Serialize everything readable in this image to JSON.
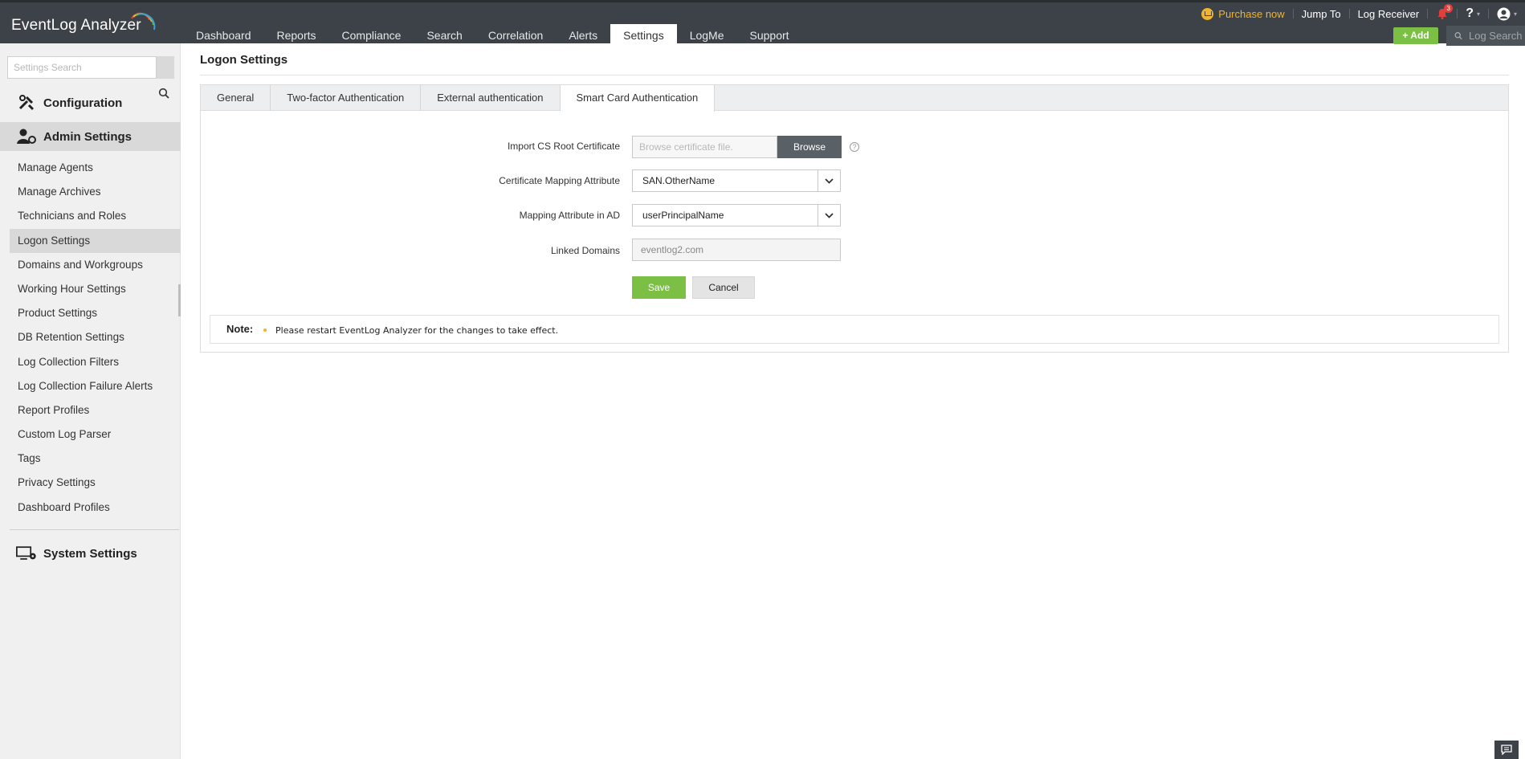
{
  "app": {
    "name": "EventLog Analyzer"
  },
  "top_nav": {
    "items": [
      "Dashboard",
      "Reports",
      "Compliance",
      "Search",
      "Correlation",
      "Alerts",
      "Settings",
      "LogMe",
      "Support"
    ],
    "active": "Settings"
  },
  "top_right": {
    "purchase": "Purchase now",
    "jump_to": "Jump To",
    "log_receiver": "Log Receiver",
    "notification_count": "3",
    "help": "?",
    "add": "Add",
    "log_search_placeholder": "Log Search"
  },
  "sidebar": {
    "search_placeholder": "Settings Search",
    "sections": {
      "configuration": "Configuration",
      "admin": "Admin Settings",
      "system": "System Settings"
    },
    "admin_items": [
      "Manage Agents",
      "Manage Archives",
      "Technicians and Roles",
      "Logon Settings",
      "Domains and Workgroups",
      "Working Hour Settings",
      "Product Settings",
      "DB Retention Settings",
      "Log Collection Filters",
      "Log Collection Failure Alerts",
      "Report Profiles",
      "Custom Log Parser",
      "Tags",
      "Privacy Settings",
      "Dashboard Profiles"
    ],
    "active_item": "Logon Settings"
  },
  "page": {
    "title": "Logon Settings",
    "tabs": [
      "General",
      "Two-factor Authentication",
      "External authentication",
      "Smart Card Authentication"
    ],
    "active_tab": "Smart Card Authentication"
  },
  "form": {
    "import_cert_label": "Import CS Root Certificate",
    "import_cert_placeholder": "Browse certificate file.",
    "browse": "Browse",
    "cert_mapping_label": "Certificate Mapping Attribute",
    "cert_mapping_value": "SAN.OtherName",
    "ad_mapping_label": "Mapping Attribute in AD",
    "ad_mapping_value": "userPrincipalName",
    "linked_domains_label": "Linked Domains",
    "linked_domains_value": "eventlog2.com",
    "save": "Save",
    "cancel": "Cancel"
  },
  "note": {
    "label": "Note:",
    "text": "Please restart EventLog Analyzer for the changes to take effect."
  },
  "colors": {
    "header_bg": "#3c4247",
    "accent_green": "#7cbf45",
    "purchase_yellow": "#f2b32e",
    "sidebar_bg": "#f0f0f0"
  }
}
